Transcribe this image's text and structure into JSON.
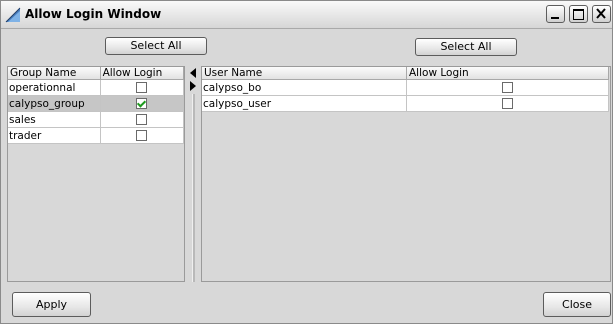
{
  "window": {
    "title": "Allow Login  Window",
    "icon": "app-logo-icon"
  },
  "window_controls": {
    "minimize": "minimize-icon",
    "maximize": "maximize-icon",
    "close": "close-icon"
  },
  "groups_panel": {
    "select_all_label": "Select All",
    "columns": [
      "Group Name",
      "Allow Login"
    ],
    "rows": [
      {
        "name": "operationnal",
        "allow_login": false
      },
      {
        "name": "calypso_group",
        "allow_login": true,
        "selected": true
      },
      {
        "name": "sales",
        "allow_login": false
      },
      {
        "name": "trader",
        "allow_login": false
      }
    ]
  },
  "users_panel": {
    "select_all_label": "Select All",
    "columns": [
      "User Name",
      "Allow Login"
    ],
    "rows": [
      {
        "name": "calypso_bo",
        "allow_login": false
      },
      {
        "name": "calypso_user",
        "allow_login": false
      }
    ]
  },
  "footer": {
    "apply_label": "Apply",
    "close_label": "Close"
  },
  "colors": {
    "window_bg": "#d8d8d8",
    "selected_row": "#c6c6c6",
    "check_mark": "#1d9a1d"
  }
}
